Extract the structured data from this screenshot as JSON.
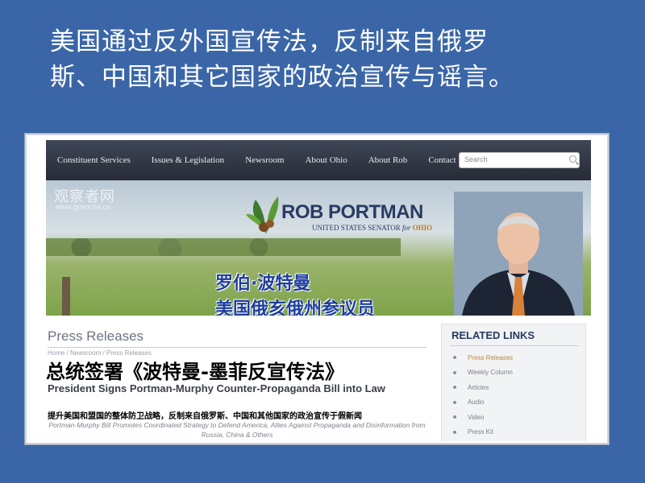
{
  "slide": {
    "title_line1": "美国通过反外国宣传法，反制来自俄罗",
    "title_line2": "斯、中国和其它国家的政治宣传与谣言。"
  },
  "nav": {
    "items": [
      "Constituent Services",
      "Issues & Legislation",
      "Newsroom",
      "About Ohio",
      "About Rob",
      "Contact"
    ],
    "search_placeholder": "Search"
  },
  "banner": {
    "watermark": "观察者网",
    "watermark_sub": "www.guancha.cn",
    "logo_name": "ROB PORTMAN",
    "logo_sub_prefix": "UNITED STATES SENATOR",
    "logo_sub_for": "for",
    "logo_sub_state": "OHIO",
    "cn_name_line1": "罗伯·波特曼",
    "cn_name_line2": "美国俄亥俄州参议员"
  },
  "content": {
    "section_title": "Press Releases",
    "breadcrumb": "Home / Newsroom / Press Releases",
    "cn_headline": "总统签署《波特曼-墨菲反宣传法》",
    "headline": "President Signs Portman-Murphy Counter-Propaganda Bill into Law",
    "cn_sub": "提升美国和盟国的整体防卫战略，反制来自俄罗斯、中国和其他国家的政治宣传于假新闻",
    "subhead": "Portman-Murphy Bill Promotes Coordinated Strategy to Defend America, Allies Against Propaganda and Disinformation from Russia, China & Others"
  },
  "sidebar": {
    "title": "RELATED LINKS",
    "items": [
      "Press Releases",
      "Weekly Column",
      "Articles",
      "Audio",
      "Video",
      "Press Kit"
    ],
    "active_index": 0
  },
  "colors": {
    "slide_bg": "#3a66a8",
    "nav_bg": "#2c3240",
    "logo_navy": "#2a3b63",
    "logo_orange": "#c47a1a",
    "active_link": "#c2882e"
  }
}
